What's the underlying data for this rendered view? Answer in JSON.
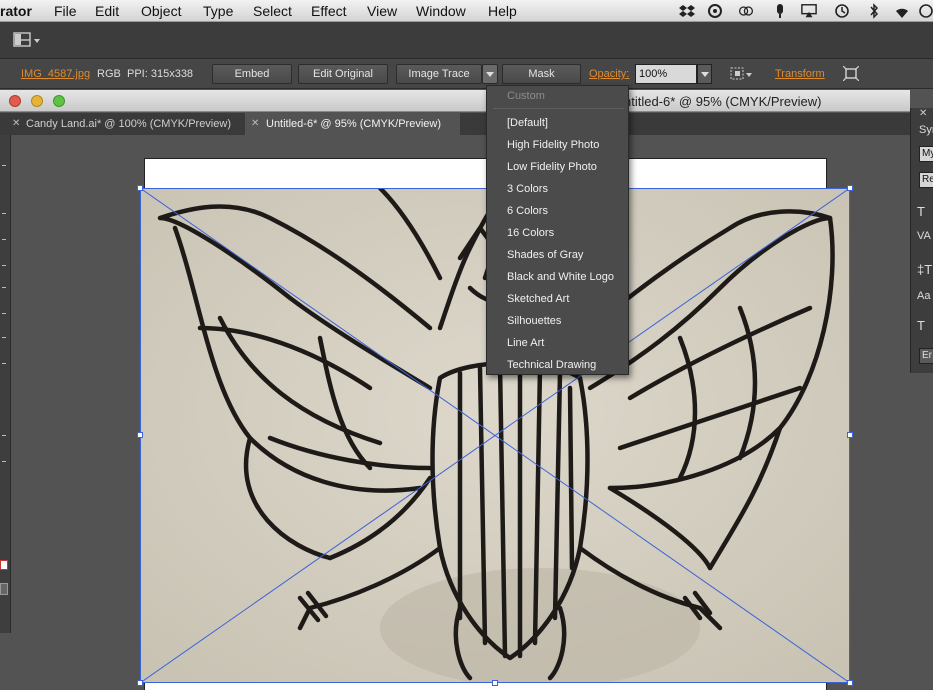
{
  "menubar": {
    "app_name": "rator",
    "items": [
      "File",
      "Edit",
      "Object",
      "Type",
      "Select",
      "Effect",
      "View",
      "Window",
      "Help"
    ]
  },
  "status_icons": [
    "dropbox-icon",
    "cloud-icon",
    "creative-cloud-icon",
    "microphone-icon",
    "airplay-icon",
    "time-machine-icon",
    "bluetooth-icon",
    "wifi-icon"
  ],
  "controlbar": {
    "file_link": "IMG_4587.jpg",
    "color_mode": "RGB",
    "ppi": "PPI: 315x338",
    "embed_label": "Embed",
    "edit_original_label": "Edit Original",
    "image_trace_label": "Image Trace",
    "mask_label": "Mask",
    "opacity_label": "Opacity:",
    "opacity_value": "100%",
    "transform_label": "Transform"
  },
  "document": {
    "window_title": "ntitled-6* @ 95% (CMYK/Preview)",
    "tabs": [
      {
        "label": "Candy Land.ai* @ 100% (CMYK/Preview)",
        "active": false
      },
      {
        "label": "Untitled-6* @ 95% (CMYK/Preview)",
        "active": true
      }
    ]
  },
  "trace_menu": {
    "header": "Custom",
    "items": [
      "[Default]",
      "High Fidelity Photo",
      "Low Fidelity Photo",
      "3 Colors",
      "6 Colors",
      "16 Colors",
      "Shades of Gray",
      "Black and White Logo",
      "Sketched Art",
      "Silhouettes",
      "Line Art",
      "Technical Drawing"
    ]
  },
  "right_panel": {
    "title": "Syn",
    "field1": "My",
    "field2": "Re",
    "button": "Er"
  },
  "colors": {
    "accent_link": "#e08a2e",
    "selection": "#3d63d8",
    "menu_bg": "#4b4b4b",
    "ui_dark": "#3c3c3c"
  }
}
